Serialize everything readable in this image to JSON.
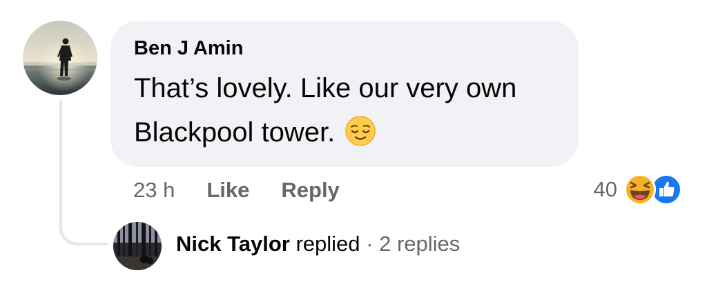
{
  "comment": {
    "author": "Ben J Amin",
    "text": "That’s lovely. Like our very own Blackpool tower.",
    "emoji": "relieved-face-icon"
  },
  "actions": {
    "timestamp": "23 h",
    "like_label": "Like",
    "reply_label": "Reply"
  },
  "reactions": {
    "count": "40",
    "types": [
      "haha-icon",
      "like-icon"
    ]
  },
  "replies": {
    "name": "Nick Taylor",
    "verb": "replied",
    "separator": "·",
    "count_label": "2 replies"
  },
  "colors": {
    "bubble": "#f0f2f5",
    "secondary_text": "#65676b",
    "primary_text": "#050505",
    "like_blue": "#1877f2",
    "haha_yellow": "#f7b125"
  }
}
